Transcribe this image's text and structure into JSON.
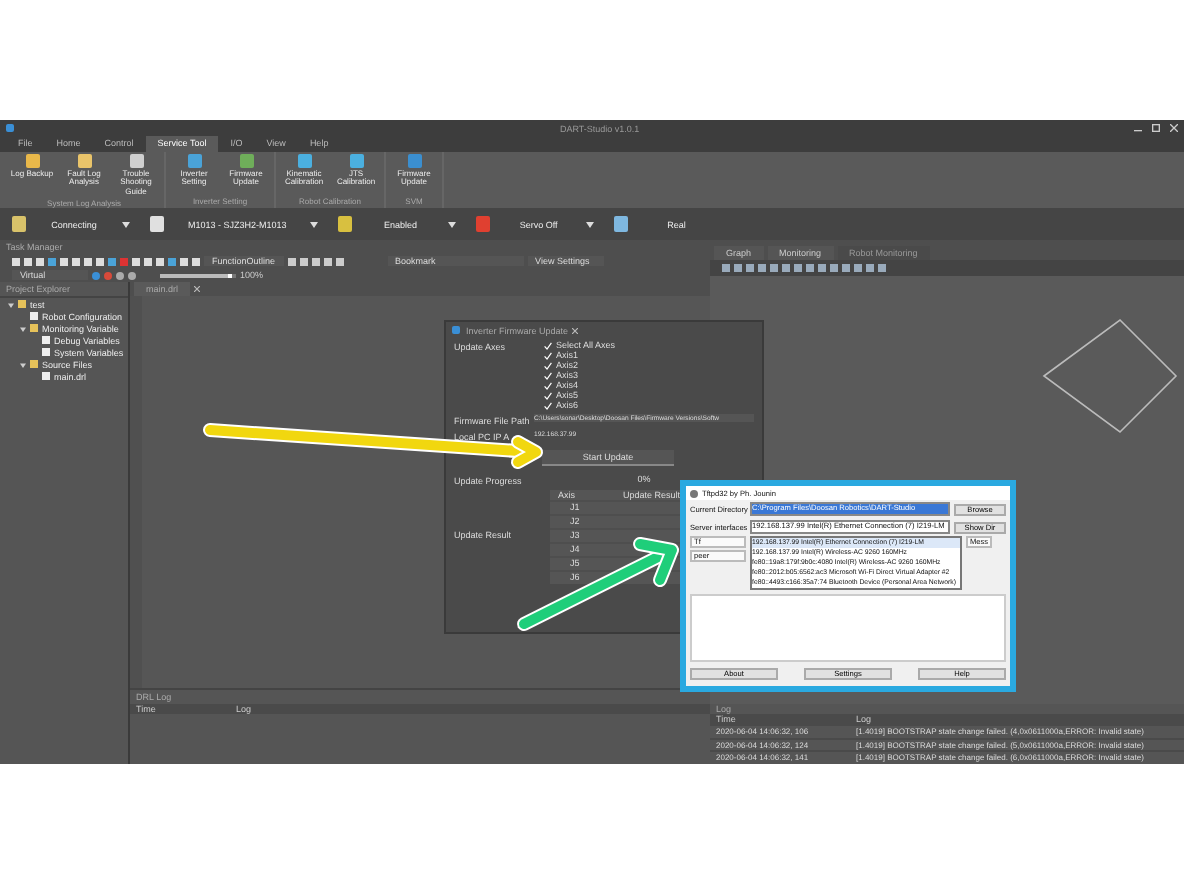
{
  "window": {
    "title": "DART-Studio v1.0.1"
  },
  "menu_tabs": [
    {
      "label": "File",
      "selected": false
    },
    {
      "label": "Home",
      "selected": false
    },
    {
      "label": "Control",
      "selected": false
    },
    {
      "label": "Service Tool",
      "selected": true
    },
    {
      "label": "I/O",
      "selected": false
    },
    {
      "label": "View",
      "selected": false
    },
    {
      "label": "Help",
      "selected": false
    }
  ],
  "ribbon_groups": [
    {
      "label": "System Log Analysis",
      "buttons": [
        "Log Backup",
        "Fault Log Analysis",
        "Trouble Shooting Guide"
      ]
    },
    {
      "label": "Inverter Setting",
      "buttons": [
        "Inverter Setting",
        "Firmware Update"
      ]
    },
    {
      "label": "Robot Calibration",
      "buttons": [
        "Kinematic Calibration",
        "JTS Calibration"
      ]
    },
    {
      "label": "SVM",
      "buttons": [
        "Firmware Update"
      ]
    }
  ],
  "status_toolbar": [
    {
      "label": "Connecting",
      "dropdown": true
    },
    {
      "label": "M1013 - SJZ3H2-M1013",
      "dropdown": true
    },
    {
      "label": "Enabled",
      "dropdown": true
    },
    {
      "label": "Servo Off",
      "dropdown": true
    },
    {
      "label": "Real",
      "dropdown": false
    }
  ],
  "task_manager": {
    "title": "Task Manager",
    "function_outline": "FunctionOutline",
    "bookmark": "Bookmark",
    "view_settings": "View Settings",
    "mode": "Virtual",
    "zoom_slider": {
      "level": 0.9
    },
    "zoom": "100%"
  },
  "project_explorer": {
    "title": "Project Explorer",
    "tree": [
      {
        "label": "test",
        "expanded": true,
        "children": [
          {
            "label": "Robot Configuration"
          },
          {
            "label": "Monitoring Variable",
            "expanded": true,
            "children": [
              {
                "label": "Debug Variables"
              },
              {
                "label": "System Variables"
              }
            ]
          },
          {
            "label": "Source Files",
            "expanded": true,
            "children": [
              {
                "label": "main.drl"
              }
            ]
          }
        ]
      }
    ]
  },
  "editor_tab": "main.drl",
  "right_tabs": [
    {
      "label": "Graph",
      "selected": false
    },
    {
      "label": "Monitoring",
      "selected": false
    },
    {
      "label": "Robot Monitoring",
      "selected": true
    }
  ],
  "firmware_dialog": {
    "title": "Inverter Firmware Update",
    "update_axes_label": "Update Axes",
    "axes": [
      {
        "label": "Select All Axes",
        "checked": true
      },
      {
        "label": "Axis1",
        "checked": true
      },
      {
        "label": "Axis2",
        "checked": true
      },
      {
        "label": "Axis3",
        "checked": true
      },
      {
        "label": "Axis4",
        "checked": true
      },
      {
        "label": "Axis5",
        "checked": true
      },
      {
        "label": "Axis6",
        "checked": true
      }
    ],
    "file_path_label": "Firmware File Path",
    "file_path": "C:\\Users\\sonar\\Desktop\\Doosan Files\\Firmware Versions\\Softw",
    "ip_label": "Local PC IP A",
    "ip": "192.168.37.99",
    "start_button": "Start Update",
    "progress_label": "Update Progress",
    "progress": "0%",
    "result_label": "Update Result",
    "result_columns": [
      "Axis",
      "Update Result"
    ],
    "result_rows": [
      "J1",
      "J2",
      "J3",
      "J4",
      "J5",
      "J6"
    ]
  },
  "tftpd_dialog": {
    "title": "Tftpd32 by Ph. Jounin",
    "dir_label": "Current Directory",
    "dir": "C:\\Program Files\\Doosan Robotics\\DART-Studio",
    "browse": "Browse",
    "show_dir": "Show Dir",
    "iface_label": "Server interfaces",
    "iface_value": "192.168.137.99      Intel(R) Ethernet Connection (7) I219-LM",
    "tab": "Tf",
    "peer": "peer",
    "more": "Mess",
    "options": [
      {
        "label": "192.168.137.99      Intel(R) Ethernet Connection (7) I219-LM",
        "selected": true
      },
      {
        "label": "192.168.137.99      Intel(R) Wireless-AC 9260 160MHz",
        "selected": false
      },
      {
        "label": "fe80::19a8:179f:9b0c:4080 Intel(R) Wireless-AC 9260 160MHz",
        "selected": false
      },
      {
        "label": "fe80::2012:b05:6562:ac3 Microsoft Wi-Fi Direct Virtual Adapter #2",
        "selected": false
      },
      {
        "label": "fe80::4493:c166:35a7:74 Bluetooth Device (Personal Area Network)",
        "selected": false
      }
    ],
    "buttons": [
      "About",
      "Settings",
      "Help"
    ]
  },
  "drl_log": {
    "title": "DRL Log",
    "columns": [
      "Time",
      "Log"
    ]
  },
  "log": {
    "title": "Log",
    "columns": [
      "Time",
      "Log"
    ],
    "rows": [
      {
        "time": "2020-06-04 14:06:32, 106",
        "message": "[1.4019] BOOTSTRAP state change failed. (4,0x0611000a,ERROR: Invalid state)"
      },
      {
        "time": "2020-06-04 14:06:32, 124",
        "message": "[1.4019] BOOTSTRAP state change failed. (5,0x0611000a,ERROR: Invalid state)"
      },
      {
        "time": "2020-06-04 14:06:32, 141",
        "message": "[1.4019] BOOTSTRAP state change failed. (6,0x0611000a,ERROR: Invalid state)"
      }
    ]
  }
}
